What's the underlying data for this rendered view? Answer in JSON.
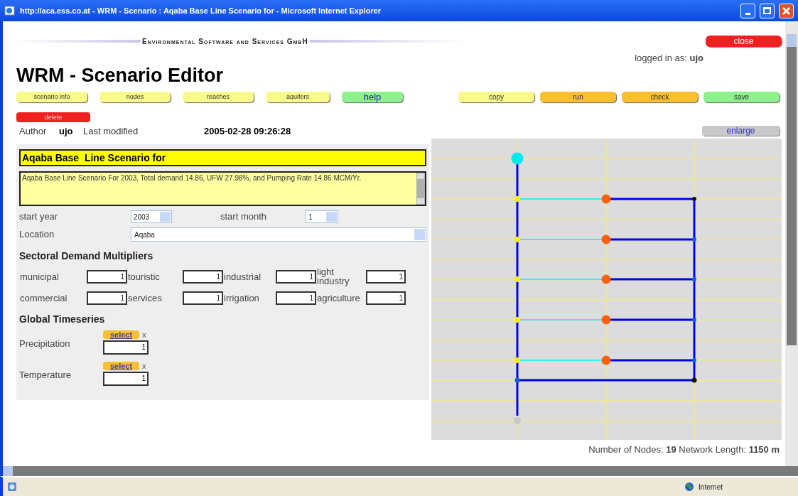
{
  "window": {
    "title": "http://aca.ess.co.at - WRM - Scenario : Aqaba Base Line Scenario for - Microsoft Internet Explorer"
  },
  "header": {
    "company": "Environmental Software and Services GmbH",
    "close": "close",
    "logged_in": "logged in as: **ujo**"
  },
  "page_title": "WRM - Scenario Editor",
  "toolbar_left": [
    {
      "label": "scenario info",
      "color": "#fafa8c"
    },
    {
      "label": "nodes",
      "color": "#fafa8c"
    },
    {
      "label": "reaches",
      "color": "#fafa8c"
    },
    {
      "label": "aquifers",
      "color": "#fafa8c"
    },
    {
      "label": "help",
      "color": "#8ef08e"
    }
  ],
  "toolbar_right": [
    {
      "label": "copy",
      "color": "#fafa8c"
    },
    {
      "label": "run",
      "color": "#f8c030"
    },
    {
      "label": "check",
      "color": "#f8c030"
    },
    {
      "label": "save",
      "color": "#8ef08e"
    }
  ],
  "delete": "delete",
  "author": {
    "label": "Author",
    "value": "ujo",
    "modified_label": "Last modified",
    "modified": "2005-02-28 09:26:28"
  },
  "enlarge": "enlarge",
  "scenario": {
    "name": "Aqaba Base  Line Scenario for",
    "description": "Aqaba Base Line Scenario For 2003, Total demand 14.86, UFW 27.98%, and Pumping Rate 14.86 MCM/Yr."
  },
  "start_year": {
    "label": "start year",
    "value": "2003"
  },
  "start_month": {
    "label": "start month",
    "value": "1"
  },
  "location": {
    "label": "Location",
    "value": "Aqaba"
  },
  "multipliers": {
    "heading": "Sectoral Demand Multipliers",
    "items": [
      {
        "label": "municipal",
        "value": "1"
      },
      {
        "label": "touristic",
        "value": "1"
      },
      {
        "label": "industrial",
        "value": "1"
      },
      {
        "label": "light industry",
        "value": "1"
      },
      {
        "label": "commercial",
        "value": "1"
      },
      {
        "label": "services",
        "value": "1"
      },
      {
        "label": "irrigation",
        "value": "1"
      },
      {
        "label": "agriculture",
        "value": "1"
      }
    ]
  },
  "timeseries": {
    "heading": "Global Timeseries",
    "items": [
      {
        "label": "Precipitation",
        "select": "select",
        "remove": "x",
        "value": "1"
      },
      {
        "label": "Temperature",
        "select": "select",
        "remove": "x",
        "value": "1"
      }
    ]
  },
  "network_stats": "Number of Nodes: **19** Network Length: **1150 m**",
  "status_bar": {
    "zone": "Internet"
  }
}
